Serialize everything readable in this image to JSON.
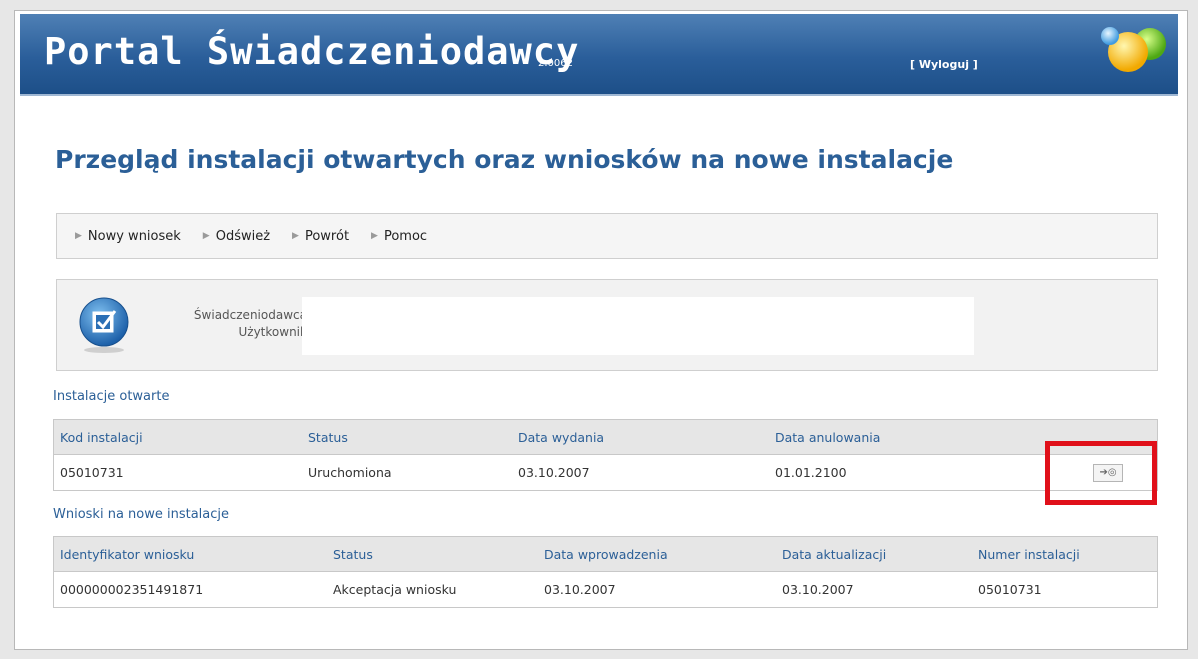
{
  "header": {
    "app_title": "Portal Świadczeniodawcy",
    "version": "2.0062",
    "logout_label": "[ Wyloguj ]"
  },
  "page": {
    "title": "Przegląd instalacji otwartych oraz wniosków na nowe instalacje"
  },
  "toolbar": {
    "items": [
      {
        "label": "Nowy wniosek",
        "icon": "arrow-right-icon"
      },
      {
        "label": "Odśwież",
        "icon": "arrow-right-icon"
      },
      {
        "label": "Powrót",
        "icon": "arrow-right-icon"
      },
      {
        "label": "Pomoc",
        "icon": "arrow-right-icon"
      }
    ]
  },
  "user_info": {
    "provider_label": "Świadczeniodawca:",
    "user_label": "Użytkownik:",
    "provider_value": "",
    "user_value": ""
  },
  "open_installations": {
    "title": "Instalacje otwarte",
    "columns": [
      "Kod instalacji",
      "Status",
      "Data wydania",
      "Data anulowania",
      ""
    ],
    "rows": [
      {
        "kod": "05010731",
        "status": "Uruchomiona",
        "data_wydania": "03.10.2007",
        "data_anulowania": "01.01.2100",
        "action_icon": "details-arrow-icon"
      }
    ]
  },
  "new_requests": {
    "title": "Wnioski na nowe instalacje",
    "columns": [
      "Identyfikator wniosku",
      "Status",
      "Data wprowadzenia",
      "Data aktualizacji",
      "Numer instalacji"
    ],
    "rows": [
      {
        "id": "000000002351491871",
        "status": "Akceptacja wniosku",
        "data_wprowadzenia": "03.10.2007",
        "data_aktualizacji": "03.10.2007",
        "numer": "05010731"
      }
    ]
  },
  "colors": {
    "header_blue": "#2a5e9a",
    "title_blue": "#2b5f97",
    "highlight_red": "#e0101a"
  }
}
